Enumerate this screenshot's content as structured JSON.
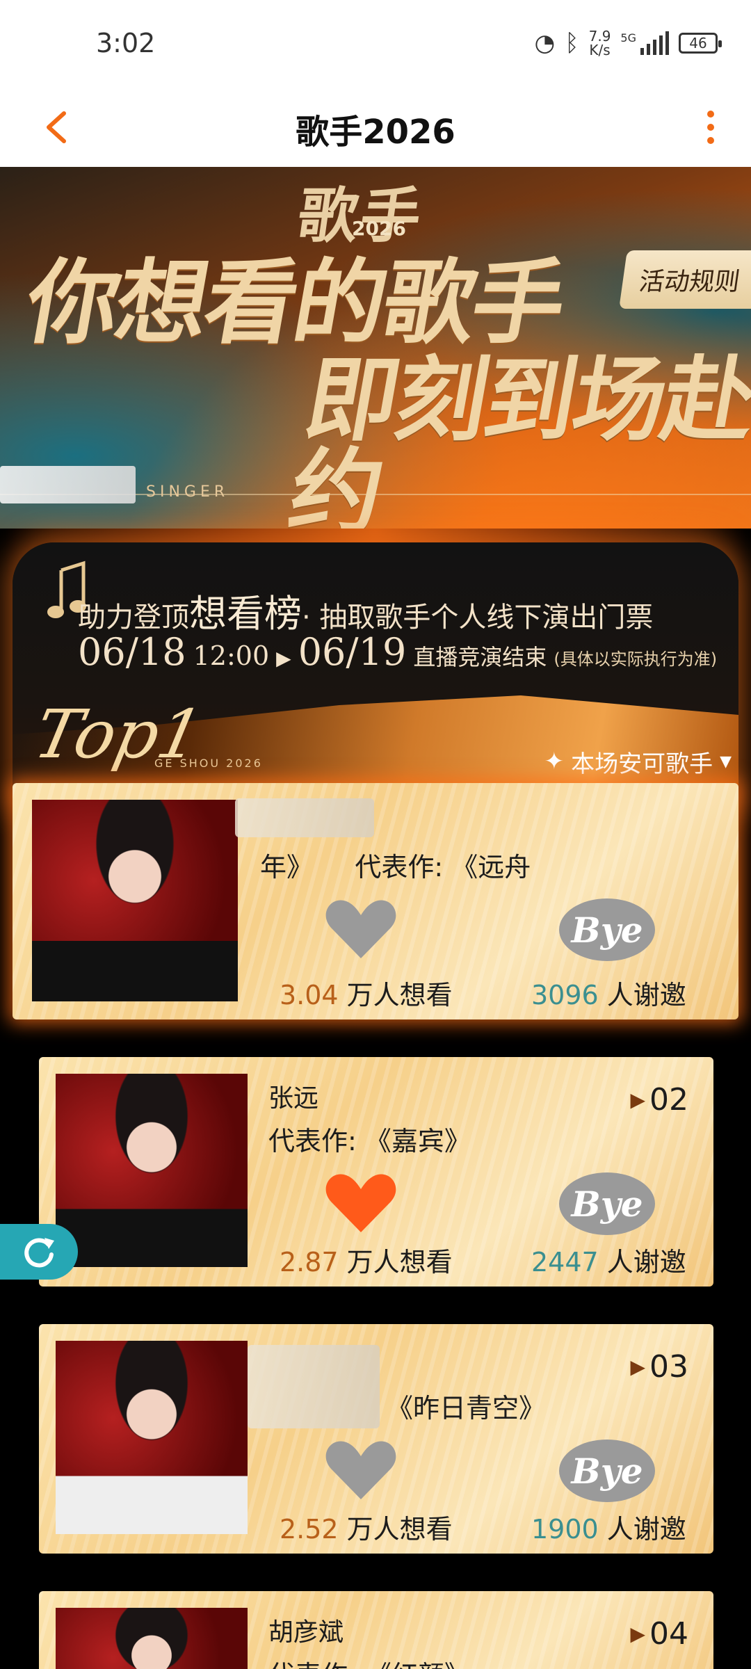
{
  "status": {
    "time": "3:02",
    "speed_value": "7.9",
    "speed_unit": "K/s",
    "network": "5G",
    "battery": "46"
  },
  "header": {
    "title": "歌手2026"
  },
  "banner": {
    "logo": "歌手",
    "year": "2026",
    "headline_1": "你想看的歌手",
    "headline_2": "即刻到场赴约",
    "singer_text": "SINGER",
    "rules_button": "活动规则"
  },
  "promo": {
    "line1_prefix": "助力登顶",
    "line1_big": "想看榜",
    "line1_suffix": "· 抽取歌手个人线下演出门票",
    "start_date": "06/18",
    "start_time": "12:00",
    "end_date": "06/19",
    "end_text": "直播竞演结束",
    "note": "(具体以实际执行为准)"
  },
  "leaderboard": {
    "top_label": "Top1",
    "sub_label": "GE SHOU 2026",
    "filter_label": "本场安可歌手",
    "stat_want_suffix": "万人想看",
    "stat_bye_suffix": "人谢邀",
    "bye_label": "Bye",
    "items": [
      {
        "name": "",
        "work": "代表作: 《远舟",
        "work_prefix": "年》",
        "want": "3.04",
        "bye": "3096",
        "liked": false
      },
      {
        "rank": "02",
        "name": "张远",
        "work": "代表作: 《嘉宾》",
        "want": "2.87",
        "bye": "2447",
        "liked": true
      },
      {
        "rank": "03",
        "name": "",
        "work": "《昨日青空》",
        "want": "2.52",
        "bye": "1900",
        "liked": false
      },
      {
        "rank": "04",
        "name": "胡彦斌",
        "work": "代表作: 《红颜》"
      }
    ]
  },
  "colors": {
    "accent": "#f26b16",
    "heart_active": "#ff5a1a",
    "heart_inactive": "#9a9a9a",
    "teal": "#3b8f90"
  }
}
